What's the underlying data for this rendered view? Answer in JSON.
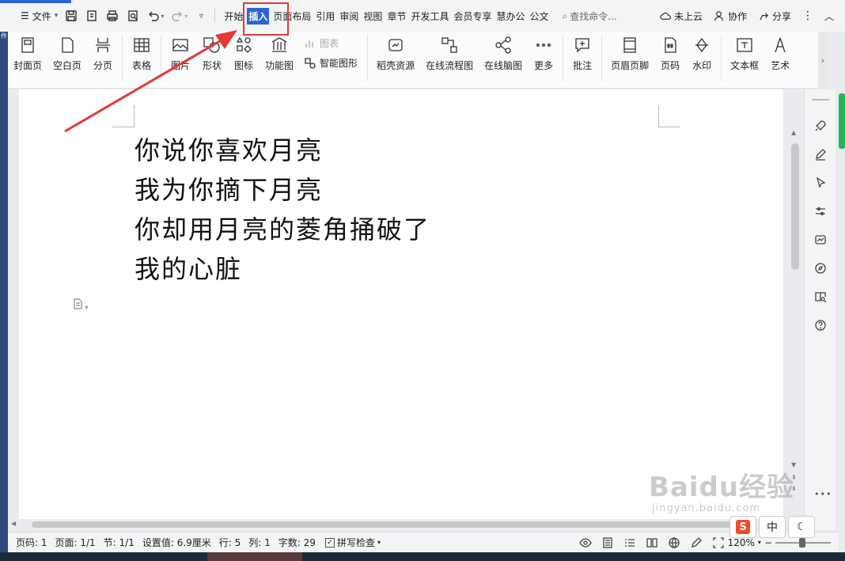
{
  "menubar": {
    "file_label": "文件",
    "tabs": [
      {
        "label": "开始",
        "active": false
      },
      {
        "label": "插入",
        "active": true
      },
      {
        "label": "页面布局",
        "active": false
      },
      {
        "label": "引用",
        "active": false
      },
      {
        "label": "审阅",
        "active": false
      },
      {
        "label": "视图",
        "active": false
      },
      {
        "label": "章节",
        "active": false
      },
      {
        "label": "开发工具",
        "active": false
      },
      {
        "label": "会员专享",
        "active": false
      },
      {
        "label": "慧办公",
        "active": false
      },
      {
        "label": "公文",
        "active": false
      }
    ],
    "search_placeholder": "查找命令...",
    "cloud_label": "未上云",
    "collab_label": "协作",
    "share_label": "分享"
  },
  "ribbon": {
    "cover": "封面页",
    "blank": "空白页",
    "page_break": "分页",
    "table": "表格",
    "picture": "图片",
    "shape": "形状",
    "icon": "图标",
    "function_chart": "功能图",
    "chart": "图表",
    "smart_shape": "智能图形",
    "daoke": "稻壳资源",
    "flowchart": "在线流程图",
    "mindmap": "在线脑图",
    "more": "更多",
    "comment": "批注",
    "header_footer": "页眉页脚",
    "page_number": "页码",
    "watermark": "水印",
    "textbox": "文本框",
    "art": "艺术"
  },
  "document": {
    "lines": [
      "你说你喜欢月亮",
      "我为你摘下月亮",
      "你却用月亮的菱角捅破了",
      "我的心脏"
    ]
  },
  "status": {
    "page_num": "页码: 1",
    "page": "页面: 1/1",
    "section": "节: 1/1",
    "setting": "设置值: 6.9厘米",
    "row": "行: 5",
    "col": "列: 1",
    "word_count": "字数: 29",
    "spell_check": "拼写检查",
    "zoom": "120%"
  },
  "ime": {
    "logo": "S",
    "mode": "中"
  },
  "watermark": {
    "main": "Baidu经验",
    "sub": "jingyan.baidu.com"
  },
  "colors": {
    "accent": "#2b64d8",
    "annotation": "#e53935"
  }
}
